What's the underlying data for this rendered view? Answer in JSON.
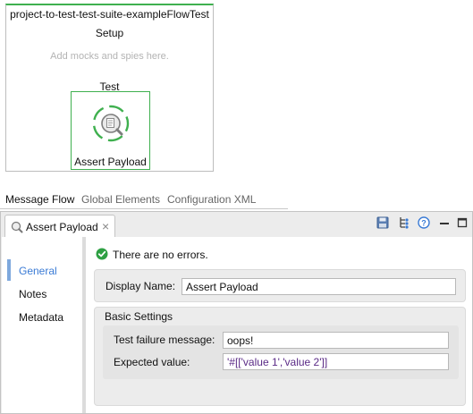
{
  "flow": {
    "title": "project-to-test-test-suite-exampleFlowTest",
    "setup_label": "Setup",
    "setup_hint": "Add mocks and spies here.",
    "test_label": "Test",
    "processor": {
      "label": "Assert Payload",
      "icon": "magnifier-document-icon"
    }
  },
  "editor_tabs": [
    {
      "label": "Message Flow",
      "active": true
    },
    {
      "label": "Global Elements",
      "active": false
    },
    {
      "label": "Configuration XML",
      "active": false
    }
  ],
  "properties": {
    "tab_label": "Assert Payload",
    "status_text": "There are no errors.",
    "nav": [
      {
        "label": "General",
        "selected": true
      },
      {
        "label": "Notes",
        "selected": false
      },
      {
        "label": "Metadata",
        "selected": false
      }
    ],
    "display_name_label": "Display Name:",
    "display_name_value": "Assert Payload",
    "basic_settings_title": "Basic Settings",
    "failure_message_label": "Test failure message:",
    "failure_message_value": "oops!",
    "expected_value_label": "Expected value:",
    "expected_value_value": "'#[['value 1','value 2']]"
  },
  "toolbar_icons": [
    "save-icon",
    "tree-icon",
    "help-icon",
    "minimize-icon",
    "maximize-icon"
  ],
  "colors": {
    "accent_green": "#3fb04f",
    "selected_blue": "#3a7bd5",
    "status_green": "#2ea043"
  }
}
